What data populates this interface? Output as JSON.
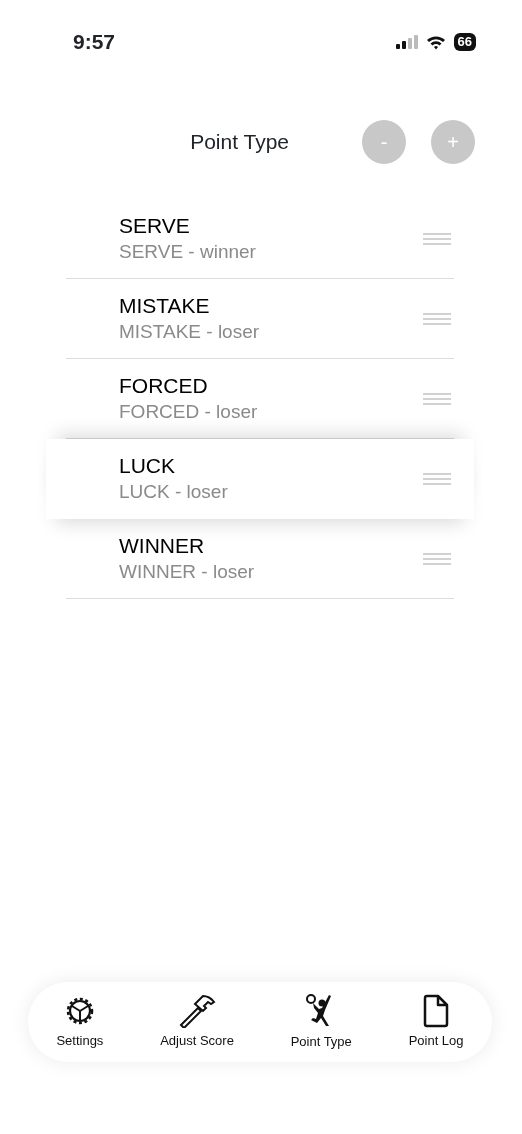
{
  "status_bar": {
    "time": "9:57",
    "battery": "66"
  },
  "header": {
    "title": "Point Type",
    "buttons": [
      "-",
      "+"
    ]
  },
  "point_types": [
    {
      "name": "SERVE",
      "detail": "SERVE - winner",
      "dragging": false
    },
    {
      "name": "MISTAKE",
      "detail": "MISTAKE - loser",
      "dragging": false
    },
    {
      "name": "FORCED",
      "detail": "FORCED - loser",
      "dragging": false
    },
    {
      "name": "LUCK",
      "detail": "LUCK - loser",
      "dragging": true
    },
    {
      "name": "WINNER",
      "detail": "WINNER - loser",
      "dragging": false
    }
  ],
  "tab_bar": [
    {
      "kind": "settings",
      "label": "Settings"
    },
    {
      "kind": "adjust",
      "label": "Adjust Score"
    },
    {
      "kind": "point",
      "label": "Point Type"
    },
    {
      "kind": "log",
      "label": "Point Log"
    }
  ]
}
